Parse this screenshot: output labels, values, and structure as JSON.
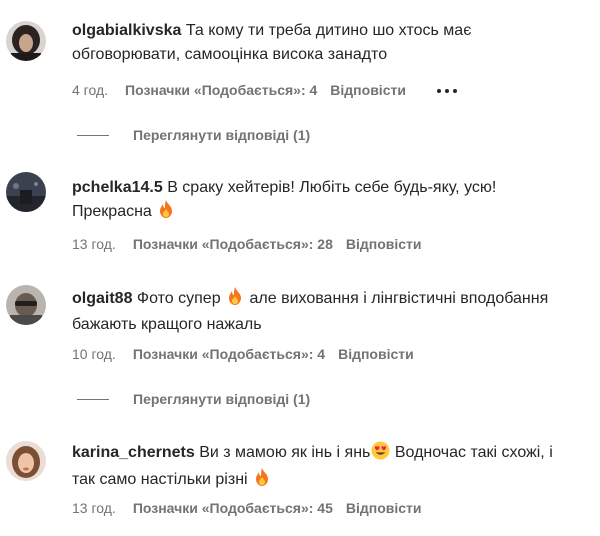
{
  "comments": [
    {
      "username": "olgabialkivska",
      "text": "Та кому ти треба дитино шо хтось має обговорювати, самооцінка висока занадто",
      "time": "4 год.",
      "likes": "Позначки «Подобається»: 4",
      "reply": "Відповісти",
      "view_replies": "Переглянути відповіді (1)"
    },
    {
      "username": "pchelka14.5",
      "text": "В сраку хейтерів! Любіть себе будь-яку, усю! Прекрасна",
      "time": "13 год.",
      "likes": "Позначки «Подобається»: 28",
      "reply": "Відповісти"
    },
    {
      "username": "olgait88",
      "text_part1": "Фото супер",
      "text_part2": "але виховання і лінгвістичні вподобання бажають кращого нажаль",
      "time": "10 год.",
      "likes": "Позначки «Подобається»: 4",
      "reply": "Відповісти",
      "view_replies": "Переглянути відповіді (1)"
    },
    {
      "username": "karina_chernets",
      "text_part1": "Ви з мамою як інь і янь",
      "text_part2": "Водночас такі схожі, і так само настільки різні",
      "time": "13 год.",
      "likes": "Позначки «Подобається»: 45",
      "reply": "Відповісти"
    }
  ],
  "icons": {
    "fire": "fire-emoji",
    "heart_eyes": "heart-eyes-emoji",
    "more": "more-options-icon"
  },
  "colors": {
    "text": "#262626",
    "secondary": "#737373",
    "fire": "#f5761a"
  }
}
